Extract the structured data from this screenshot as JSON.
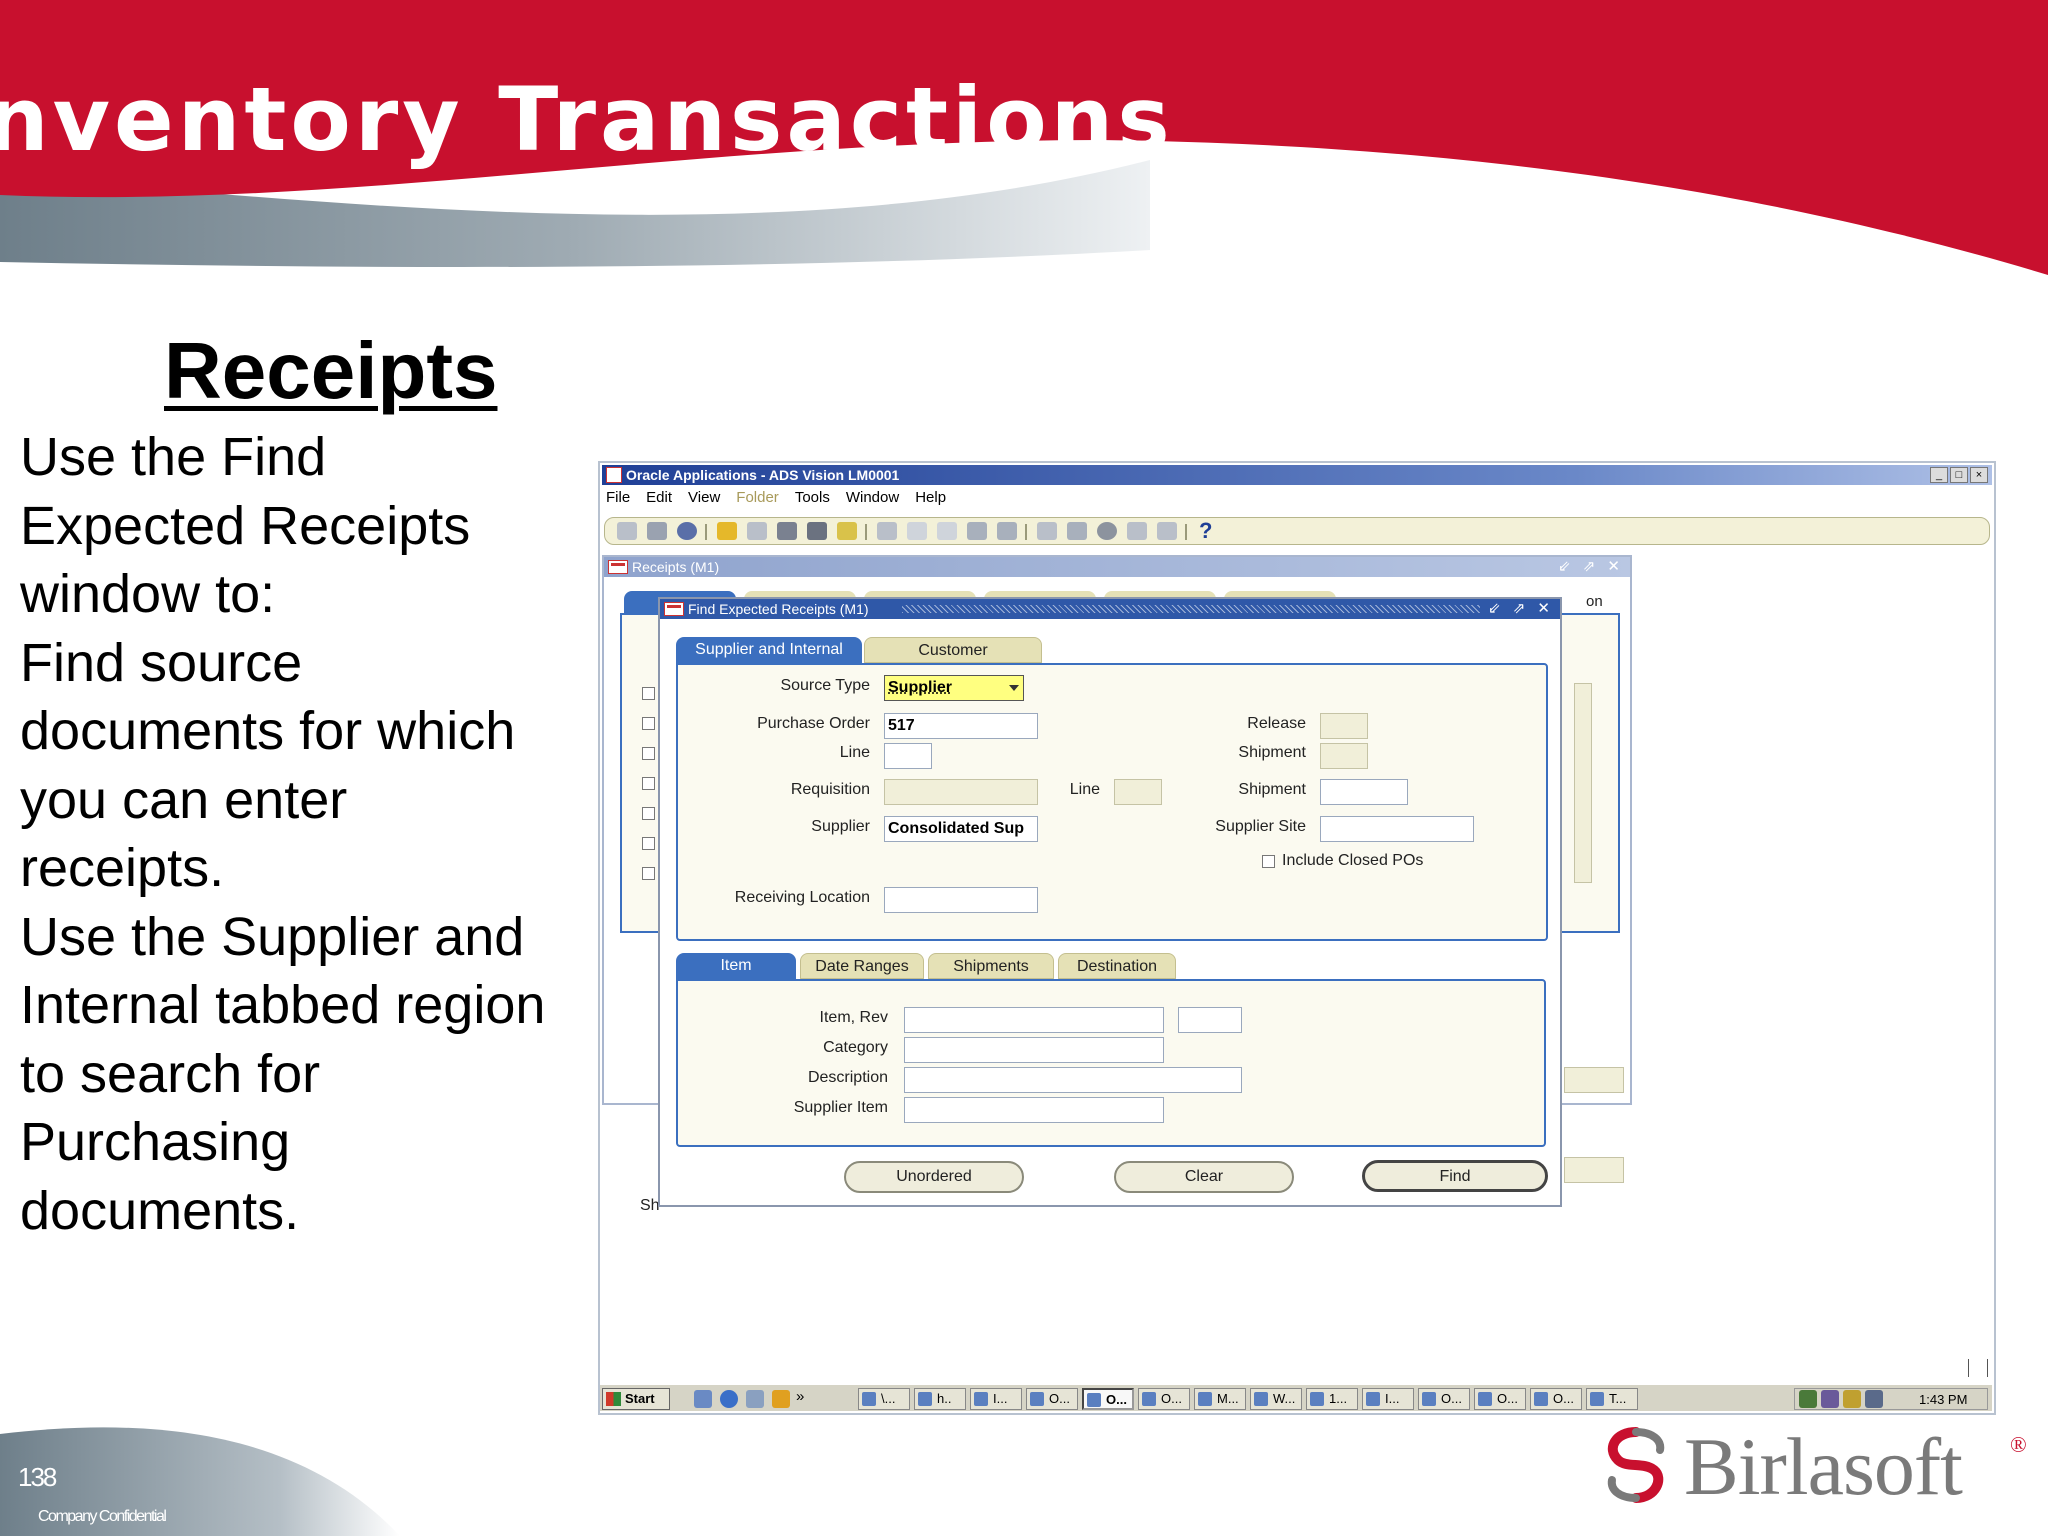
{
  "slide": {
    "title": "nventory Transactions",
    "section_title": "Receipts",
    "body_lines": [
      "Use the Find",
      "Expected Receipts",
      "window to:",
      "Find source",
      "documents for which",
      "you can enter",
      "receipts.",
      "Use the Supplier and",
      "Internal tabbed region",
      "to search for",
      "Purchasing",
      "documents."
    ],
    "page_number": "138",
    "confidential": "Company Confidential",
    "logo_text": "Birlasoft",
    "logo_reg": "®",
    "colors": {
      "header_red": "#c8102e",
      "header_gray": "#7a8a96"
    }
  },
  "app": {
    "window_title": "Oracle Applications - ADS Vision LM0001",
    "window_controls": [
      "_",
      "□",
      "×"
    ],
    "menu": [
      "File",
      "Edit",
      "View",
      "Folder",
      "Tools",
      "Window",
      "Help"
    ],
    "disabled_menu": "Folder",
    "toolbar_help": "?",
    "receipts_title": "Receipts (M1)",
    "receipts_partial_tab": "on",
    "receipts_partial_label": "Sh",
    "find_title": "Find Expected Receipts (M1)",
    "frame_controls": "⇙ ⇗ ✕",
    "top_tabs": [
      "Supplier and Internal",
      "Customer"
    ],
    "fields": {
      "source_type_label": "Source Type",
      "source_type_value": "Supplier",
      "purchase_order_label": "Purchase Order",
      "purchase_order_value": "517",
      "po_line_label": "Line",
      "release_label": "Release",
      "shipment_label_1": "Shipment",
      "requisition_label": "Requisition",
      "req_line_label": "Line",
      "shipment_label_2": "Shipment",
      "supplier_label": "Supplier",
      "supplier_value": "Consolidated Sup",
      "supplier_site_label": "Supplier Site",
      "include_closed_label": "Include Closed POs",
      "receiving_location_label": "Receiving Location"
    },
    "bottom_tabs": [
      "Item",
      "Date Ranges",
      "Shipments",
      "Destination"
    ],
    "item_fields": {
      "item_rev_label": "Item, Rev",
      "category_label": "Category",
      "description_label": "Description",
      "supplier_item_label": "Supplier Item"
    },
    "buttons": [
      "Unordered",
      "Clear",
      "Find"
    ],
    "taskbar": {
      "start": "Start",
      "chevron": "»",
      "items": [
        "\\...",
        "h..",
        "I...",
        "O...",
        "O...",
        "O...",
        "M...",
        "W...",
        "1...",
        "I...",
        "O...",
        "O...",
        "O...",
        "T..."
      ],
      "active_index": 4,
      "clock": "1:43 PM"
    }
  }
}
